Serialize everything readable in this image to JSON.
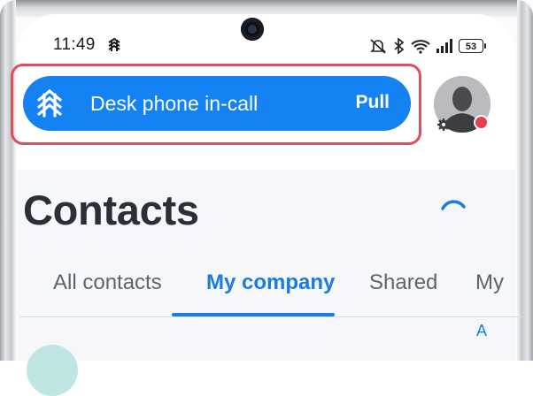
{
  "status_bar": {
    "time": "11:49",
    "battery": "53"
  },
  "call_banner": {
    "label": "Desk phone in-call",
    "action": "Pull"
  },
  "page": {
    "title": "Contacts"
  },
  "tabs": [
    {
      "label": "All contacts",
      "active": false
    },
    {
      "label": "My company",
      "active": true
    },
    {
      "label": "Shared",
      "active": false
    },
    {
      "label": "My",
      "active": false
    }
  ],
  "alpha_index": {
    "first_letter": "A"
  },
  "colors": {
    "accent": "#1582f3",
    "highlight": "#dc4f5e",
    "presence_busy": "#e53e4d"
  }
}
